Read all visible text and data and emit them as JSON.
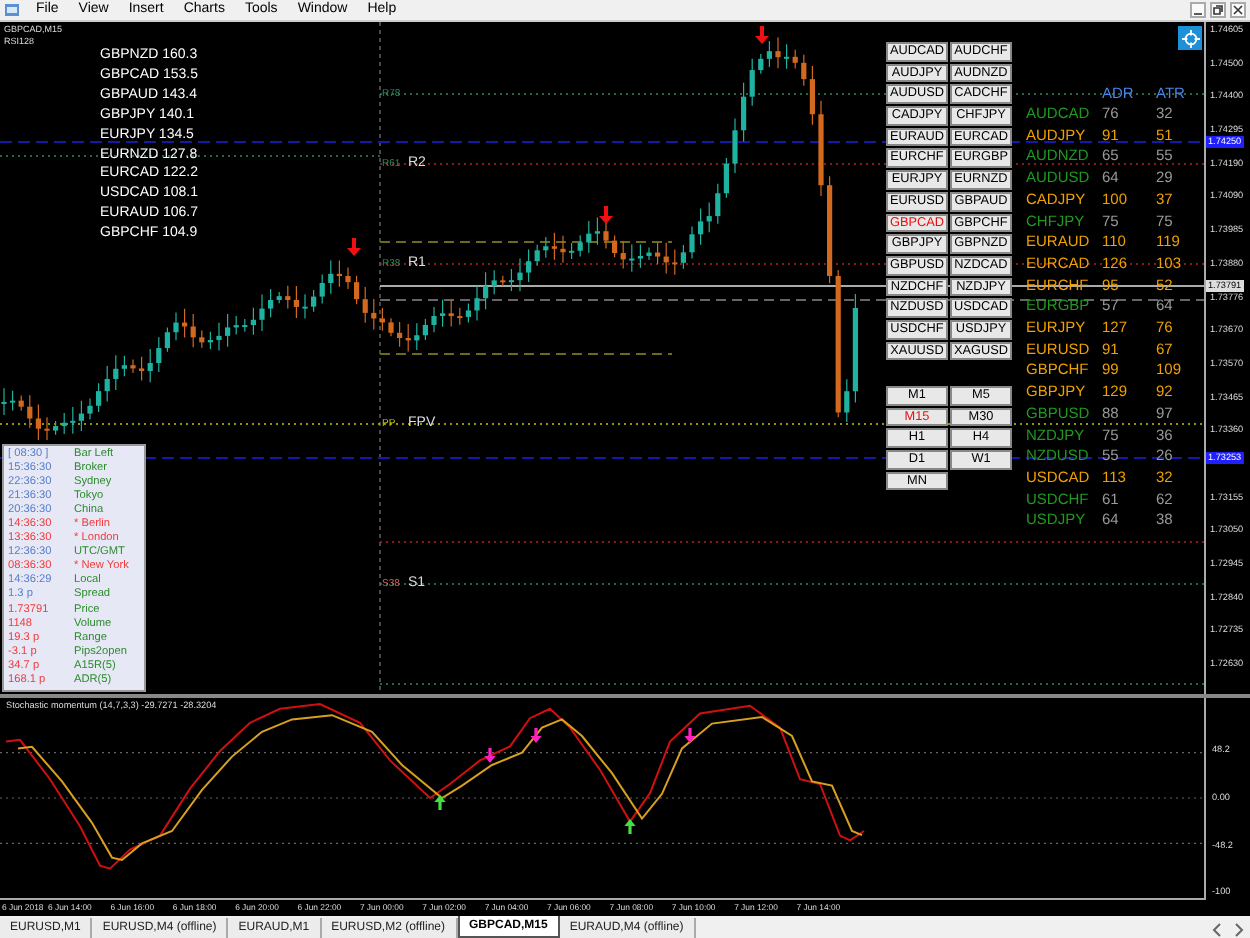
{
  "menu": [
    "File",
    "View",
    "Insert",
    "Charts",
    "Tools",
    "Window",
    "Help"
  ],
  "chart": {
    "symbol": "GBPCAD,M15",
    "indicator": "RSI128",
    "strength_list": [
      {
        "pair": "GBPNZD",
        "value": "160.3"
      },
      {
        "pair": "GBPCAD",
        "value": "153.5"
      },
      {
        "pair": "GBPAUD",
        "value": "143.4"
      },
      {
        "pair": "GBPJPY",
        "value": "140.1"
      },
      {
        "pair": "EURJPY",
        "value": "134.5"
      },
      {
        "pair": "EURNZD",
        "value": "127.8"
      },
      {
        "pair": "EURCAD",
        "value": "122.2"
      },
      {
        "pair": "USDCAD",
        "value": "108.1"
      },
      {
        "pair": "EURAUD",
        "value": "106.7"
      },
      {
        "pair": "GBPCHF",
        "value": "104.9"
      }
    ],
    "levels": [
      {
        "code": "R78"
      },
      {
        "code": "R61",
        "name": "R2"
      },
      {
        "code": "R38",
        "name": "R1"
      },
      {
        "code": "PP",
        "name": "FPV"
      },
      {
        "code": "S38",
        "name": "S1"
      }
    ],
    "symbol_buttons": [
      {
        "label": "AUDCAD",
        "selected": false
      },
      {
        "label": "AUDCHF",
        "selected": false
      },
      {
        "label": "AUDJPY",
        "selected": false
      },
      {
        "label": "AUDNZD",
        "selected": false
      },
      {
        "label": "AUDUSD",
        "selected": false
      },
      {
        "label": "CADCHF",
        "selected": false
      },
      {
        "label": "CADJPY",
        "selected": false
      },
      {
        "label": "CHFJPY",
        "selected": false
      },
      {
        "label": "EURAUD",
        "selected": false
      },
      {
        "label": "EURCAD",
        "selected": false
      },
      {
        "label": "EURCHF",
        "selected": false
      },
      {
        "label": "EURGBP",
        "selected": false
      },
      {
        "label": "EURJPY",
        "selected": false
      },
      {
        "label": "EURNZD",
        "selected": false
      },
      {
        "label": "EURUSD",
        "selected": false
      },
      {
        "label": "GBPAUD",
        "selected": false
      },
      {
        "label": "GBPCAD",
        "selected": true
      },
      {
        "label": "GBPCHF",
        "selected": false
      },
      {
        "label": "GBPJPY",
        "selected": false
      },
      {
        "label": "GBPNZD",
        "selected": false
      },
      {
        "label": "GBPUSD",
        "selected": false
      },
      {
        "label": "NZDCAD",
        "selected": false
      },
      {
        "label": "NZDCHF",
        "selected": false
      },
      {
        "label": "NZDJPY",
        "selected": false
      },
      {
        "label": "NZDUSD",
        "selected": false
      },
      {
        "label": "USDCAD",
        "selected": false
      },
      {
        "label": "USDCHF",
        "selected": false
      },
      {
        "label": "USDJPY",
        "selected": false
      },
      {
        "label": "XAUUSD",
        "selected": false
      },
      {
        "label": "XAGUSD",
        "selected": false
      }
    ],
    "timeframe_buttons": [
      {
        "label": "M1",
        "selected": false
      },
      {
        "label": "M5",
        "selected": false
      },
      {
        "label": "M15",
        "selected": true
      },
      {
        "label": "M30",
        "selected": false
      },
      {
        "label": "H1",
        "selected": false
      },
      {
        "label": "H4",
        "selected": false
      },
      {
        "label": "D1",
        "selected": false
      },
      {
        "label": "W1",
        "selected": false
      },
      {
        "label": "MN",
        "selected": false
      }
    ],
    "adr_table": {
      "columns": [
        "ADR",
        "ATR"
      ],
      "rows": [
        {
          "symbol": "AUDCAD",
          "adr": "76",
          "atr": "32",
          "color": "#1f9a1f"
        },
        {
          "symbol": "AUDJPY",
          "adr": "91",
          "atr": "51",
          "color": "#f0a000"
        },
        {
          "symbol": "AUDNZD",
          "adr": "65",
          "atr": "55",
          "color": "#1f9a1f"
        },
        {
          "symbol": "AUDUSD",
          "adr": "64",
          "atr": "29",
          "color": "#1f9a1f"
        },
        {
          "symbol": "CADJPY",
          "adr": "100",
          "atr": "37",
          "color": "#f0a000"
        },
        {
          "symbol": "CHFJPY",
          "adr": "75",
          "atr": "75",
          "color": "#1f9a1f"
        },
        {
          "symbol": "EURAUD",
          "adr": "110",
          "atr": "119",
          "color": "#f0a000"
        },
        {
          "symbol": "EURCAD",
          "adr": "126",
          "atr": "103",
          "color": "#f0a000"
        },
        {
          "symbol": "EURCHF",
          "adr": "95",
          "atr": "52",
          "color": "#f0a000"
        },
        {
          "symbol": "EURGBP",
          "adr": "57",
          "atr": "64",
          "color": "#1f9a1f"
        },
        {
          "symbol": "EURJPY",
          "adr": "127",
          "atr": "76",
          "color": "#f0a000"
        },
        {
          "symbol": "EURUSD",
          "adr": "91",
          "atr": "67",
          "color": "#f0a000"
        },
        {
          "symbol": "GBPCHF",
          "adr": "99",
          "atr": "109",
          "color": "#f0a000"
        },
        {
          "symbol": "GBPJPY",
          "adr": "129",
          "atr": "92",
          "color": "#f0a000"
        },
        {
          "symbol": "GBPUSD",
          "adr": "88",
          "atr": "97",
          "color": "#1f9a1f"
        },
        {
          "symbol": "NZDJPY",
          "adr": "75",
          "atr": "36",
          "color": "#1f9a1f"
        },
        {
          "symbol": "NZDUSD",
          "adr": "55",
          "atr": "26",
          "color": "#1f9a1f"
        },
        {
          "symbol": "USDCAD",
          "adr": "113",
          "atr": "32",
          "color": "#f0a000"
        },
        {
          "symbol": "USDCHF",
          "adr": "61",
          "atr": "62",
          "color": "#1f9a1f"
        },
        {
          "symbol": "USDJPY",
          "adr": "64",
          "atr": "38",
          "color": "#1f9a1f"
        }
      ]
    },
    "info_panel": [
      {
        "value": "[ 08:30 ]",
        "label": "Bar Left",
        "color": "#5a7ec8",
        "kind": "normal"
      },
      {
        "value": "15:36:30",
        "label": "Broker",
        "color": "#5a7ec8",
        "kind": "normal"
      },
      {
        "value": "22:36:30",
        "label": "Sydney",
        "color": "#5a7ec8",
        "kind": "normal"
      },
      {
        "value": "21:36:30",
        "label": "Tokyo",
        "color": "#5a7ec8",
        "kind": "normal"
      },
      {
        "value": "20:36:30",
        "label": "China",
        "color": "#5a7ec8",
        "kind": "normal"
      },
      {
        "value": "14:36:30",
        "label": "* Berlin",
        "color": "#f03c3c",
        "kind": "alert"
      },
      {
        "value": "13:36:30",
        "label": "* London",
        "color": "#f03c3c",
        "kind": "alert"
      },
      {
        "value": "12:36:30",
        "label": "UTC/GMT",
        "color": "#5a7ec8",
        "kind": "normal"
      },
      {
        "value": "08:36:30",
        "label": "* New York",
        "color": "#f03c3c",
        "kind": "alert"
      },
      {
        "value": "14:36:29",
        "label": "Local",
        "color": "#5a7ec8",
        "kind": "normal"
      },
      {
        "value": "1.3 p",
        "label": "Spread",
        "color": "#5a7ec8",
        "kind": "normal"
      },
      {
        "value": "1.73791",
        "label": "Price",
        "color": "#f03c3c",
        "kind": "normal"
      },
      {
        "value": "1148",
        "label": "Volume",
        "color": "#f03c3c",
        "kind": "normal"
      },
      {
        "value": "19.3 p",
        "label": "Range",
        "color": "#f03c3c",
        "kind": "normal"
      },
      {
        "value": "-3.1 p",
        "label": "Pips2open",
        "color": "#f03c3c",
        "kind": "normal"
      },
      {
        "value": "34.7 p",
        "label": "A15R(5)",
        "color": "#f03c3c",
        "kind": "normal"
      },
      {
        "value": "168.1 p",
        "label": "ADR(5)",
        "color": "#f03c3c",
        "kind": "normal"
      }
    ],
    "price_axis": {
      "ticks": [
        "1.74605",
        "1.74500",
        "1.74400",
        "1.74295",
        "1.74190",
        "1.74090",
        "1.73985",
        "1.73880",
        "1.73776",
        "1.73670",
        "1.73570",
        "1.73465",
        "1.73360",
        "1.73155",
        "1.73050",
        "1.72945",
        "1.72840",
        "1.72735",
        "1.72630"
      ],
      "markers": [
        {
          "text": "1.74250",
          "kind": "line"
        },
        {
          "text": "1.73791",
          "kind": "bid"
        },
        {
          "text": "1.73253",
          "kind": "line"
        }
      ]
    }
  },
  "subwindow": {
    "title": "Stochastic momentum (14,7,3,3) -29.7271 -28.3204",
    "ticks": [
      "48.2",
      "0.00",
      "-48.2",
      "-100"
    ]
  },
  "time_axis": [
    "6 Jun 2018",
    "6 Jun 14:00",
    "6 Jun 16:00",
    "6 Jun 18:00",
    "6 Jun 20:00",
    "6 Jun 22:00",
    "7 Jun 00:00",
    "7 Jun 02:00",
    "7 Jun 04:00",
    "7 Jun 06:00",
    "7 Jun 08:00",
    "7 Jun 10:00",
    "7 Jun 12:00",
    "7 Jun 14:00"
  ],
  "tabs": [
    {
      "label": "EURUSD,M1",
      "selected": false
    },
    {
      "label": "EURUSD,M4 (offline)",
      "selected": false
    },
    {
      "label": "EURAUD,M1",
      "selected": false
    },
    {
      "label": "EURUSD,M2 (offline)",
      "selected": false
    },
    {
      "label": "GBPCAD,M15",
      "selected": true
    },
    {
      "label": "EURAUD,M4 (offline)",
      "selected": false
    }
  ]
}
